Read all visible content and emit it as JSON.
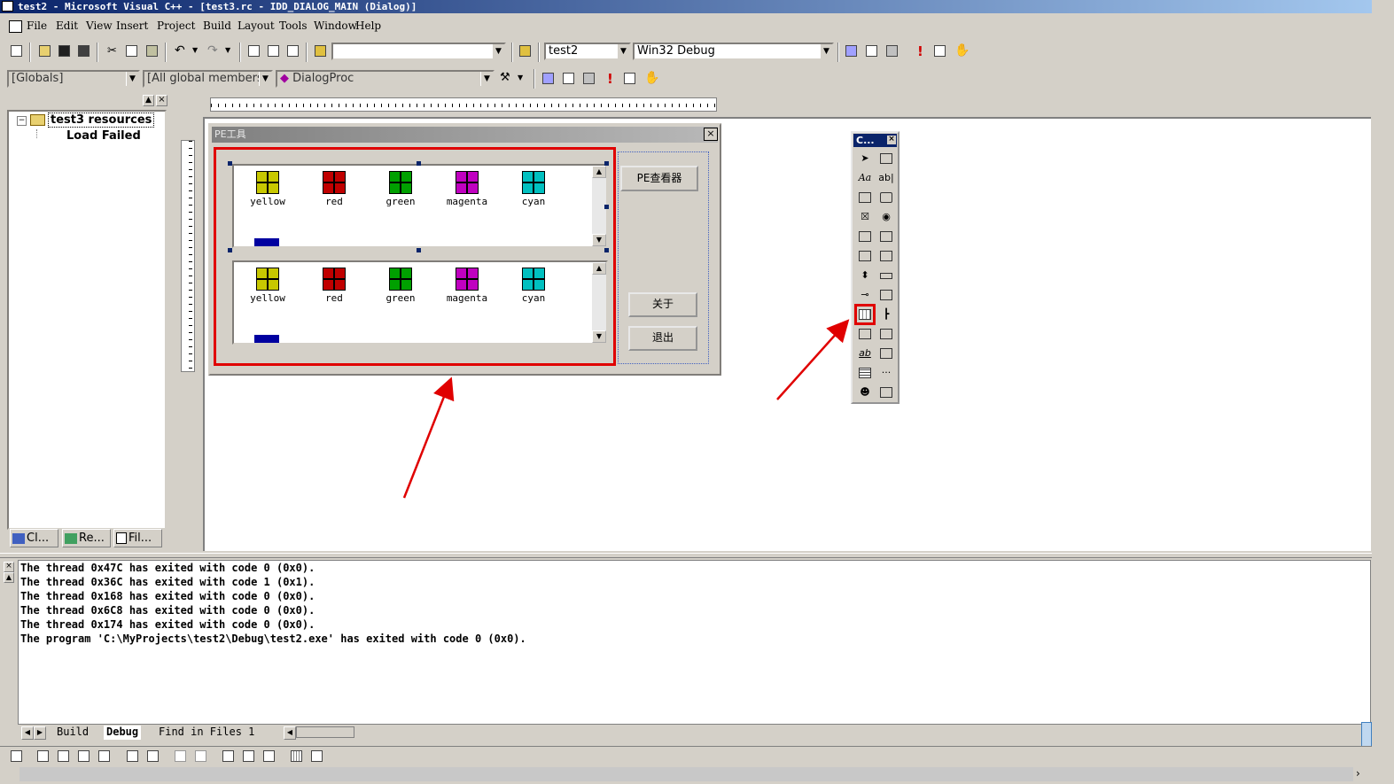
{
  "title_bar": {
    "text": "test2 - Microsoft Visual C++ - [test3.rc - IDD_DIALOG_MAIN (Dialog)]"
  },
  "menu": [
    "File",
    "Edit",
    "View",
    "Insert",
    "Project",
    "Build",
    "Layout",
    "Tools",
    "Window",
    "Help"
  ],
  "toolbar1": {
    "find_combo_value": "",
    "project_combo": "test2",
    "config_combo": "Win32 Debug"
  },
  "toolbar2": {
    "class_combo": "[Globals]",
    "members_combo": "[All global members",
    "function_combo": "DialogProc"
  },
  "workspace": {
    "root": "test3 resources",
    "child": "Load Failed",
    "tabs": [
      "Cl...",
      "Re...",
      "Fil..."
    ]
  },
  "dialog": {
    "caption": "PE工具",
    "buttons": {
      "viewer": "PE查看器",
      "about": "关于",
      "exit": "退出"
    },
    "items": [
      {
        "label": "yellow",
        "color": "#c8c800"
      },
      {
        "label": "red",
        "color": "#c00000"
      },
      {
        "label": "green",
        "color": "#00a000"
      },
      {
        "label": "magenta",
        "color": "#c000c0"
      },
      {
        "label": "cyan",
        "color": "#00c0c0"
      }
    ]
  },
  "palette": {
    "title": "C..."
  },
  "output": {
    "lines": [
      "The thread 0x47C has exited with code 0 (0x0).",
      "The thread 0x36C has exited with code 1 (0x1).",
      "The thread 0x168 has exited with code 0 (0x0).",
      "The thread 0x6C8 has exited with code 0 (0x0).",
      "The thread 0x174 has exited with code 0 (0x0).",
      "The program 'C:\\MyProjects\\test2\\Debug\\test2.exe' has exited with code 0 (0x0)."
    ],
    "tabs": [
      "Build",
      "Debug",
      "Find in Files 1"
    ]
  },
  "colors": {
    "highlight": "#e00000",
    "titlebar": "#0a246a"
  }
}
